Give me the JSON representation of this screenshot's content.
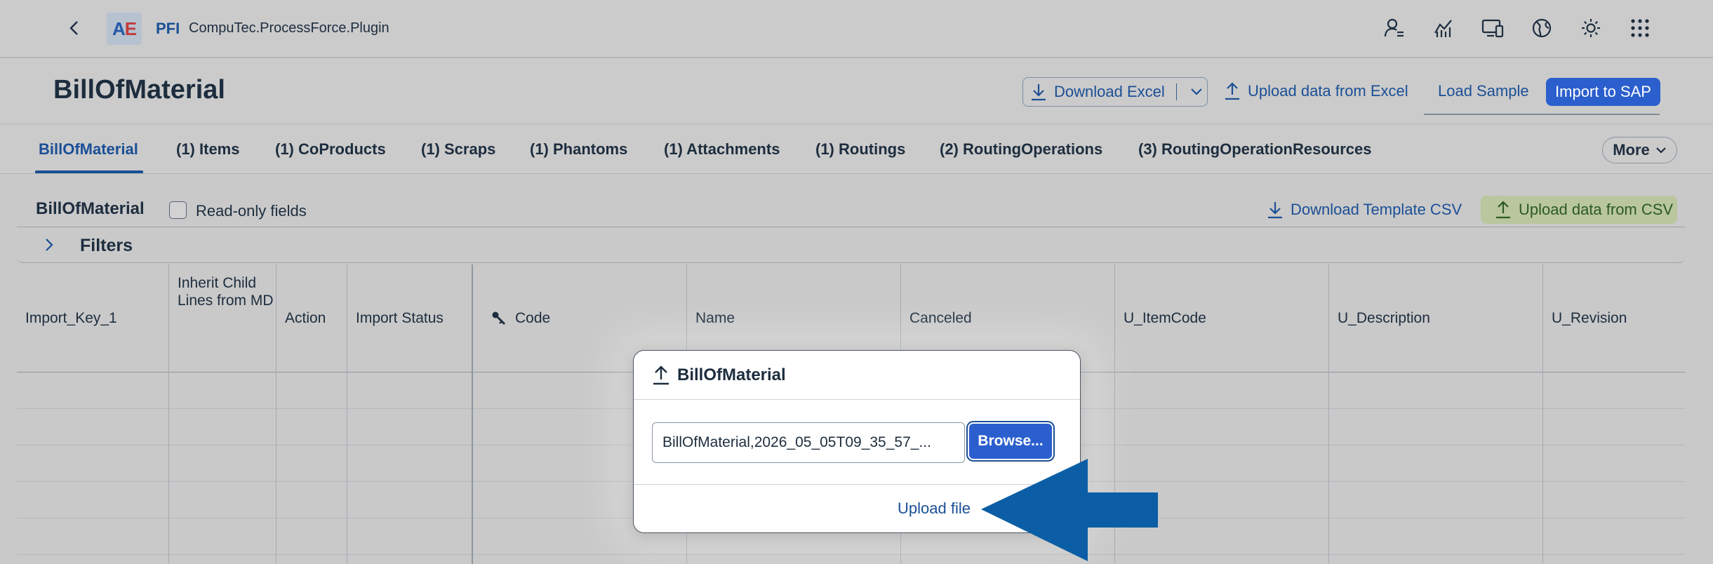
{
  "shell": {
    "logo_text_a": "A",
    "logo_text_e": "E",
    "app_abbr": "PFI",
    "app_name": "CompuTec.ProcessForce.Plugin",
    "icons": [
      "user-menu-icon",
      "analytics-icon",
      "device-icon",
      "globe-icon",
      "theme-icon",
      "app-grid-icon"
    ]
  },
  "header": {
    "title": "BillOfMaterial",
    "download_excel": "Download Excel",
    "upload_excel": "Upload data from Excel",
    "load_sample": "Load Sample",
    "import_sap": "Import to SAP"
  },
  "tabs": [
    {
      "label": "BillOfMaterial",
      "active": true
    },
    {
      "label": "(1) Items"
    },
    {
      "label": "(1) CoProducts"
    },
    {
      "label": "(1) Scraps"
    },
    {
      "label": "(1) Phantoms"
    },
    {
      "label": "(1) Attachments"
    },
    {
      "label": "(1) Routings"
    },
    {
      "label": "(2) RoutingOperations"
    },
    {
      "label": "(3) RoutingOperationResources"
    }
  ],
  "more_label": "More",
  "toolbar": {
    "title": "BillOfMaterial",
    "readonly_label": "Read-only fields",
    "download_csv": "Download Template CSV",
    "upload_csv": "Upload data from CSV"
  },
  "filters": {
    "label": "Filters"
  },
  "table": {
    "columns": [
      "Import_Key_1",
      "Inherit Child Lines from MD",
      "Action",
      "Import Status",
      "Code",
      "Name",
      "Canceled",
      "U_ItemCode",
      "U_Description",
      "U_Revision"
    ]
  },
  "dialog": {
    "title": "BillOfMaterial",
    "file_value": "BillOfMaterial,2026_05_05T09_35_57_...",
    "browse_label": "Browse...",
    "upload_label": "Upload file"
  },
  "colors": {
    "accent": "#1b4f96",
    "primary_button": "#2b5fce",
    "annotation_arrow": "#0b5ea5",
    "upload_csv_bg": "#b9c69e"
  }
}
